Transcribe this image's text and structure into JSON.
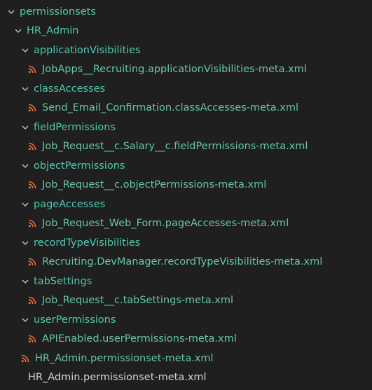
{
  "tree": {
    "root": "permissionsets",
    "admin": "HR_Admin",
    "groups": [
      {
        "folder": "applicationVisibilities",
        "file": "JobApps__Recruiting.applicationVisibilities-meta.xml"
      },
      {
        "folder": "classAccesses",
        "file": "Send_Email_Confirmation.classAccesses-meta.xml"
      },
      {
        "folder": "fieldPermissions",
        "file": "Job_Request__c.Salary__c.fieldPermissions-meta.xml"
      },
      {
        "folder": "objectPermissions",
        "file": "Job_Request__c.objectPermissions-meta.xml"
      },
      {
        "folder": "pageAccesses",
        "file": "Job_Request_Web_Form.pageAccesses-meta.xml"
      },
      {
        "folder": "recordTypeVisibilities",
        "file": "Recruiting.DevManager.recordTypeVisibilities-meta.xml"
      },
      {
        "folder": "tabSettings",
        "file": "Job_Request__c.tabSettings-meta.xml"
      },
      {
        "folder": "userPermissions",
        "file": "APIEnabled.userPermissions-meta.xml"
      }
    ],
    "admin_file": "HR_Admin.permissionset-meta.xml",
    "root_file": "HR_Admin.permissionset-meta.xml"
  },
  "icons": {
    "expanded": "chevron-down-icon",
    "file": "rss-feed-icon"
  },
  "colors": {
    "background": "#1f1f1f",
    "folder_text": "#4ec9b0",
    "file_text": "#67c4a8",
    "rss_icon": "#e8703a",
    "chevron": "#cccccc"
  }
}
